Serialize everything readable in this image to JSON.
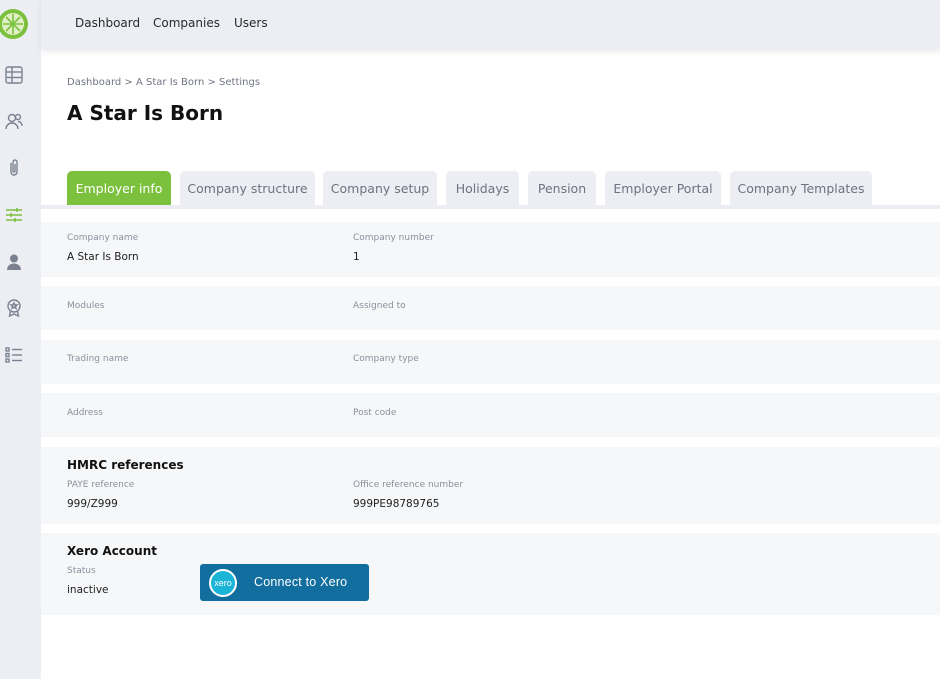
{
  "brand": {
    "accent": "#7cc13d",
    "rail_bg": "#eceef4",
    "xero_blue": "#126e9e"
  },
  "topnav": {
    "items": [
      "Dashboard",
      "Companies",
      "Users"
    ]
  },
  "sidebar": {
    "icons": [
      "table-icon",
      "users-icon",
      "paperclip-icon",
      "sliders-icon",
      "person-icon",
      "award-icon",
      "list-icon"
    ],
    "active": "sliders-icon"
  },
  "breadcrumb": "Dashboard > A Star Is Born > Settings",
  "page_title": "A Star Is Born",
  "tabs": [
    "Employer info",
    "Company structure",
    "Company setup",
    "Holidays",
    "Pension",
    "Employer Portal",
    "Company Templates"
  ],
  "active_tab": "Employer info",
  "fields": {
    "company_name": {
      "label": "Company name",
      "value": "A Star Is Born"
    },
    "company_number": {
      "label": "Company number",
      "value": "1"
    },
    "modules": {
      "label": "Modules"
    },
    "assigned_to": {
      "label": "Assigned to"
    },
    "trading_name": {
      "label": "Trading name"
    },
    "company_type": {
      "label": "Company type"
    },
    "address": {
      "label": "Address"
    },
    "post_code": {
      "label": "Post code"
    }
  },
  "hmrc": {
    "title": "HMRC references",
    "paye": {
      "label": "PAYE reference",
      "value": "999/Z999"
    },
    "office": {
      "label": "Office reference number",
      "value": "999PE98789765"
    }
  },
  "xero": {
    "title": "Xero Account",
    "status_label": "Status",
    "status_value": "inactive",
    "button_label": "Connect to Xero",
    "logo_text": "xero"
  }
}
